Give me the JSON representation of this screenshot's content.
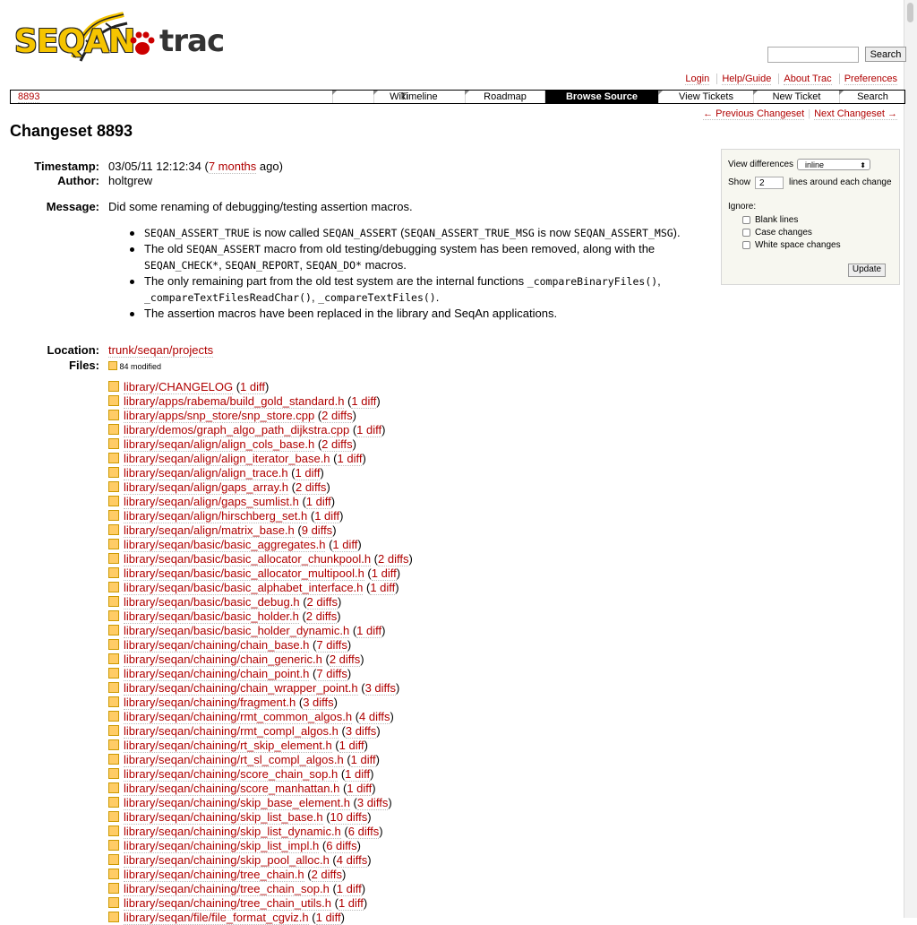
{
  "header": {
    "logo_text_left": "SEQAN",
    "logo_text_right": "trac",
    "search_button": "Search",
    "search_value": ""
  },
  "metanav": [
    "Login",
    "Help/Guide",
    "About Trac",
    "Preferences"
  ],
  "mainnav": {
    "crumb": "8893",
    "tabs": [
      {
        "label": "Wiki",
        "active": false
      },
      {
        "label": "Timeline",
        "active": false
      },
      {
        "label": "Roadmap",
        "active": false
      },
      {
        "label": "Browse Source",
        "active": true
      },
      {
        "label": "View Tickets",
        "active": false
      },
      {
        "label": "New Ticket",
        "active": false
      },
      {
        "label": "Search",
        "active": false
      }
    ]
  },
  "ctxtnav": {
    "prev": "← Previous Changeset",
    "next": "Next Changeset →"
  },
  "title": "Changeset 8893",
  "props": {
    "timestamp_label": "Timestamp:",
    "timestamp_value": "03/05/11 12:12:34",
    "timestamp_open": " (",
    "timestamp_rel": "7 months",
    "timestamp_close": " ago)",
    "author_label": "Author:",
    "author_value": "holtgrew",
    "message_label": "Message:",
    "message_intro": "Did some renaming of debugging/testing assertion macros.",
    "location_label": "Location:",
    "location_value": "trunk/seqan/projects",
    "files_label": "Files:",
    "files_legend": "84 modified"
  },
  "message_items": [
    [
      {
        "t": "SEQAN_ASSERT_TRUE",
        "c": true
      },
      {
        "t": " is now called ",
        "c": false
      },
      {
        "t": "SEQAN_ASSERT",
        "c": true
      },
      {
        "t": " (",
        "c": false
      },
      {
        "t": "SEQAN_ASSERT_TRUE_MSG",
        "c": true
      },
      {
        "t": " is now ",
        "c": false
      },
      {
        "t": "SEQAN_ASSERT_MSG",
        "c": true
      },
      {
        "t": ").",
        "c": false
      }
    ],
    [
      {
        "t": "The old ",
        "c": false
      },
      {
        "t": "SEQAN_ASSERT",
        "c": true
      },
      {
        "t": " macro from old testing/debugging system has been removed, along with the ",
        "c": false
      },
      {
        "t": "SEQAN_CHECK*",
        "c": true
      },
      {
        "t": ", ",
        "c": false
      },
      {
        "t": "SEQAN_REPORT",
        "c": true
      },
      {
        "t": ", ",
        "c": false
      },
      {
        "t": "SEQAN_DO*",
        "c": true
      },
      {
        "t": " macros.",
        "c": false
      }
    ],
    [
      {
        "t": "The only remaining part from the old test system are the internal functions ",
        "c": false
      },
      {
        "t": "_compareBinaryFiles()",
        "c": true
      },
      {
        "t": ", ",
        "c": false
      },
      {
        "t": "_compareTextFilesReadChar()",
        "c": true
      },
      {
        "t": ", ",
        "c": false
      },
      {
        "t": "_compareTextFiles()",
        "c": true
      },
      {
        "t": ".",
        "c": false
      }
    ],
    [
      {
        "t": "The assertion macros have been replaced in the library and SeqAn applications.",
        "c": false
      }
    ]
  ],
  "diff_options": {
    "view_label": "View differences",
    "view_value": "inline",
    "show_label": "Show",
    "lines_value": "2",
    "lines_suffix": "lines around each change",
    "ignore_label": "Ignore:",
    "blank_lines": "Blank lines",
    "case_changes": "Case changes",
    "white_space": "White space changes",
    "update": "Update"
  },
  "files": [
    {
      "path": "library/CHANGELOG",
      "diffs": "1 diff"
    },
    {
      "path": "library/apps/rabema/build_gold_standard.h",
      "diffs": "1 diff"
    },
    {
      "path": "library/apps/snp_store/snp_store.cpp",
      "diffs": "2 diffs"
    },
    {
      "path": "library/demos/graph_algo_path_dijkstra.cpp",
      "diffs": "1 diff"
    },
    {
      "path": "library/seqan/align/align_cols_base.h",
      "diffs": "2 diffs"
    },
    {
      "path": "library/seqan/align/align_iterator_base.h",
      "diffs": "1 diff"
    },
    {
      "path": "library/seqan/align/align_trace.h",
      "diffs": "1 diff"
    },
    {
      "path": "library/seqan/align/gaps_array.h",
      "diffs": "2 diffs"
    },
    {
      "path": "library/seqan/align/gaps_sumlist.h",
      "diffs": "1 diff"
    },
    {
      "path": "library/seqan/align/hirschberg_set.h",
      "diffs": "1 diff"
    },
    {
      "path": "library/seqan/align/matrix_base.h",
      "diffs": "9 diffs"
    },
    {
      "path": "library/seqan/basic/basic_aggregates.h",
      "diffs": "1 diff"
    },
    {
      "path": "library/seqan/basic/basic_allocator_chunkpool.h",
      "diffs": "2 diffs"
    },
    {
      "path": "library/seqan/basic/basic_allocator_multipool.h",
      "diffs": "1 diff"
    },
    {
      "path": "library/seqan/basic/basic_alphabet_interface.h",
      "diffs": "1 diff"
    },
    {
      "path": "library/seqan/basic/basic_debug.h",
      "diffs": "2 diffs"
    },
    {
      "path": "library/seqan/basic/basic_holder.h",
      "diffs": "2 diffs"
    },
    {
      "path": "library/seqan/basic/basic_holder_dynamic.h",
      "diffs": "1 diff"
    },
    {
      "path": "library/seqan/chaining/chain_base.h",
      "diffs": "7 diffs"
    },
    {
      "path": "library/seqan/chaining/chain_generic.h",
      "diffs": "2 diffs"
    },
    {
      "path": "library/seqan/chaining/chain_point.h",
      "diffs": "7 diffs"
    },
    {
      "path": "library/seqan/chaining/chain_wrapper_point.h",
      "diffs": "3 diffs"
    },
    {
      "path": "library/seqan/chaining/fragment.h",
      "diffs": "3 diffs"
    },
    {
      "path": "library/seqan/chaining/rmt_common_algos.h",
      "diffs": "4 diffs"
    },
    {
      "path": "library/seqan/chaining/rmt_compl_algos.h",
      "diffs": "3 diffs"
    },
    {
      "path": "library/seqan/chaining/rt_skip_element.h",
      "diffs": "1 diff"
    },
    {
      "path": "library/seqan/chaining/rt_sl_compl_algos.h",
      "diffs": "1 diff"
    },
    {
      "path": "library/seqan/chaining/score_chain_sop.h",
      "diffs": "1 diff"
    },
    {
      "path": "library/seqan/chaining/score_manhattan.h",
      "diffs": "1 diff"
    },
    {
      "path": "library/seqan/chaining/skip_base_element.h",
      "diffs": "3 diffs"
    },
    {
      "path": "library/seqan/chaining/skip_list_base.h",
      "diffs": "10 diffs"
    },
    {
      "path": "library/seqan/chaining/skip_list_dynamic.h",
      "diffs": "6 diffs"
    },
    {
      "path": "library/seqan/chaining/skip_list_impl.h",
      "diffs": "6 diffs"
    },
    {
      "path": "library/seqan/chaining/skip_pool_alloc.h",
      "diffs": "4 diffs"
    },
    {
      "path": "library/seqan/chaining/tree_chain.h",
      "diffs": "2 diffs"
    },
    {
      "path": "library/seqan/chaining/tree_chain_sop.h",
      "diffs": "1 diff"
    },
    {
      "path": "library/seqan/chaining/tree_chain_utils.h",
      "diffs": "1 diff"
    },
    {
      "path": "library/seqan/file/file_format_cgviz.h",
      "diffs": "1 diff"
    }
  ]
}
